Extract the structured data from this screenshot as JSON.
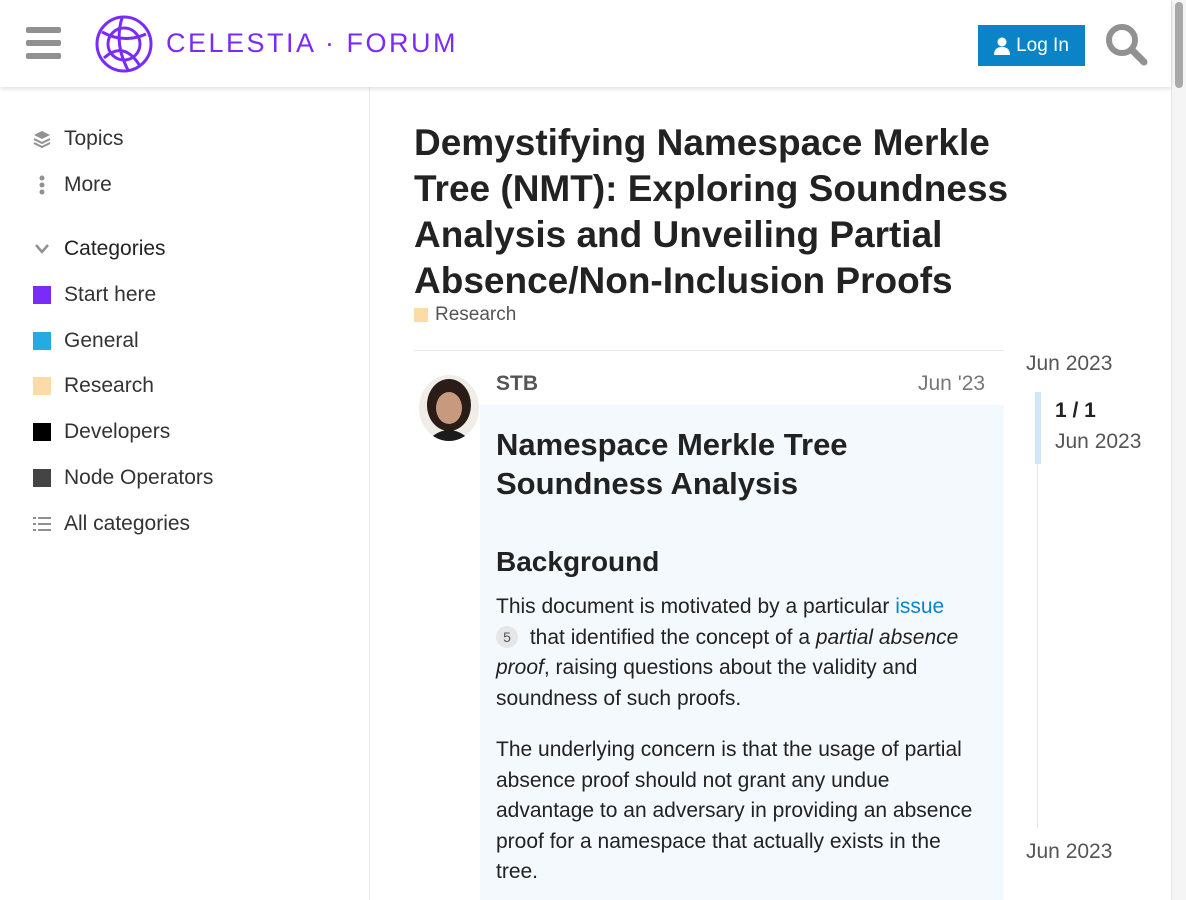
{
  "header": {
    "logo_text": "CELESTIA · FORUM",
    "login_label": "Log In",
    "brand_color": "#7b2bf9",
    "login_color": "#0a84c6"
  },
  "sidebar": {
    "topics_label": "Topics",
    "more_label": "More",
    "categories_header": "Categories",
    "categories": [
      {
        "label": "Start here",
        "color": "#7b2bf9"
      },
      {
        "label": "General",
        "color": "#25aae1"
      },
      {
        "label": "Research",
        "color": "#fcdba8"
      },
      {
        "label": "Developers",
        "color": "#000000"
      },
      {
        "label": "Node Operators",
        "color": "#444444"
      }
    ],
    "all_categories_label": "All categories"
  },
  "topic": {
    "title": "Demystifying Namespace Merkle Tree (NMT): Exploring Soundness Analysis and Unveiling Partial Absence/Non-Inclusion Proofs",
    "category": "Research",
    "category_color": "#fcdba8"
  },
  "post": {
    "author": "STB",
    "date": "Jun '23",
    "heading": "Namespace Merkle Tree Soundness Analysis",
    "subheading": "Background",
    "p1_before_link": "This document is motivated by a particular ",
    "p1_link": "issue",
    "p1_badge": "5",
    "p1_after_badge": " that identified the concept of a ",
    "p1_em": "partial absence proof",
    "p1_end": ", raising questions about the validity and soundness of such proofs.",
    "p2": "The underlying concern is that the usage of partial absence proof should not grant any undue advantage to an adversary in providing an absence proof for a namespace that actually exists in the tree."
  },
  "timeline": {
    "start_date": "Jun 2023",
    "position": "1 / 1",
    "handle_date": "Jun 2023",
    "end_date": "Jun 2023"
  }
}
